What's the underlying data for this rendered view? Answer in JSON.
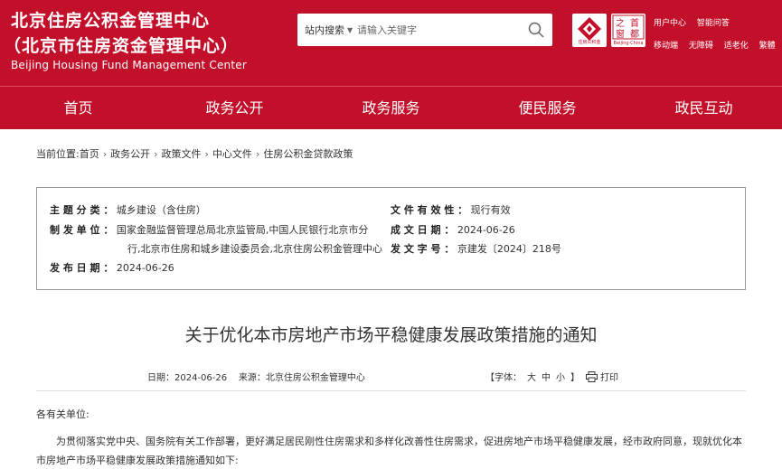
{
  "header": {
    "title_line1": "北京住房公积金管理中心",
    "title_line2": "（北京市住房资金管理中心）",
    "title_en": "Beijing Housing Fund Management Center",
    "logo1_caption": "住房公积金",
    "logo2_caption": "Beijing·China",
    "logo2_chars": [
      "之",
      "首",
      "窗",
      "都"
    ]
  },
  "search": {
    "scope": "站内搜索",
    "placeholder": "请输入关键字"
  },
  "top_links": [
    "用户中心",
    "智能问答"
  ],
  "top_links2": [
    "移动端",
    "无障碍",
    "适老化",
    "繁體"
  ],
  "nav": [
    "首页",
    "政务公开",
    "政务服务",
    "便民服务",
    "政民互动"
  ],
  "breadcrumb": {
    "prefix": "当前位置:",
    "items": [
      "首页",
      "政务公开",
      "政策文件",
      "中心文件",
      "住房公积金贷款政策"
    ]
  },
  "meta": {
    "category_label": "主 题 分 类 ：",
    "category": "城乡建设（含住房）",
    "validity_label": "文 件 有 效 性 ：",
    "validity": "现行有效",
    "issuer_label": "制 发 单 位 ：",
    "issuer_line1": "国家金融监督管理总局北京监管局,中国人民银行北京市分",
    "issuer_line2": "行,北京市住房和城乡建设委员会,北京住房公积金管理中心",
    "written_label": "成 文 日 期 ：",
    "written": "2024-06-26",
    "docno_label": "发 文 字 号 ：",
    "docno": "京建发〔2024〕218号",
    "published_label": "发 布 日 期 ：",
    "published": "2024-06-26"
  },
  "doc": {
    "title": "关于优化本市房地产市场平稳健康发展政策措施的通知",
    "date_label": "日期：",
    "date": "2024-06-26",
    "source_label": "来源：",
    "source": "北京住房公积金管理中心",
    "font_label": "【字体：",
    "font_large": "大",
    "font_medium": "中",
    "font_small": "小",
    "font_close": "】",
    "print": "打印",
    "salutation": "各有关单位:",
    "para1": "为贯彻落实党中央、国务院有关工作部署，更好满足居民刚性住房需求和多样化改善性住房需求，促进房地产市场平稳健康发展，经市政府同意，现就优化本市房地产市场平稳健康发展政策措施通知如下:"
  },
  "colors": {
    "brand_red": "#c3102a"
  }
}
